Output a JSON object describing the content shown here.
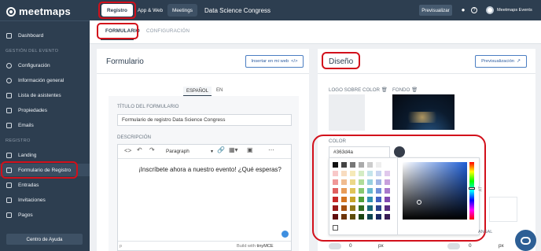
{
  "sidebar": {
    "logo": "meetmaps",
    "items_top": [
      {
        "label": "Dashboard",
        "icon": "dashboard-icon"
      }
    ],
    "section_event": "GESTIÓN DEL EVENTO",
    "items_event": [
      {
        "label": "Configuración",
        "icon": "gear-icon"
      },
      {
        "label": "Información general",
        "icon": "info-icon"
      },
      {
        "label": "Lista de asistentes",
        "icon": "list-icon"
      },
      {
        "label": "Propiedades",
        "icon": "properties-icon"
      },
      {
        "label": "Emails",
        "icon": "email-icon"
      }
    ],
    "section_registro": "REGISTRO",
    "items_registro": [
      {
        "label": "Landing",
        "icon": "landing-icon"
      },
      {
        "label": "Formulario de Registro",
        "icon": "form-icon",
        "active": true
      },
      {
        "label": "Entradas",
        "icon": "ticket-icon"
      },
      {
        "label": "Invitaciones",
        "icon": "invitation-icon"
      },
      {
        "label": "Pagos",
        "icon": "payment-icon"
      }
    ],
    "help_button": "Centro de Ayuda"
  },
  "topbar": {
    "tabs": [
      "Registro",
      "App & Web",
      "Meetings"
    ],
    "event_title": "Data Science Congress",
    "preview_button": "Previsualizar",
    "user": "Meetmaps Events"
  },
  "subtabs": [
    "FORMULARIO",
    "CONFIGURACIÓN"
  ],
  "form_panel": {
    "title": "Formulario",
    "embed_button": "Insertar en mi web",
    "languages": [
      "ESPAÑOL",
      "EN"
    ],
    "form_title_label": "TÍTULO DEL FORMULARIO",
    "form_title_value": "Formulario de registro Data Science Congress",
    "description_label": "DESCRIPCIÓN",
    "paragraph_select": "Paragraph",
    "editor_text": "¡Inscríbete ahora a nuestro evento! ¿Qué esperas?",
    "editor_footer": "Build with",
    "editor_brand": "tinyMCE",
    "editor_status": "p"
  },
  "design_panel": {
    "title": "Diseño",
    "preview_button": "Previsualización",
    "logo_label": "LOGO SOBRE COLOR",
    "background_label": "FONDO",
    "color_label": "COLOR",
    "color_value": "#363d4a",
    "accent_color": "#363d4a",
    "bottom_values": [
      "0",
      "px",
      "0",
      "px"
    ],
    "partial_label": "ANSAL"
  },
  "colors": {
    "sidebar_bg": "#2d3e50",
    "highlight": "#d2101b",
    "link": "#2e5da0"
  }
}
